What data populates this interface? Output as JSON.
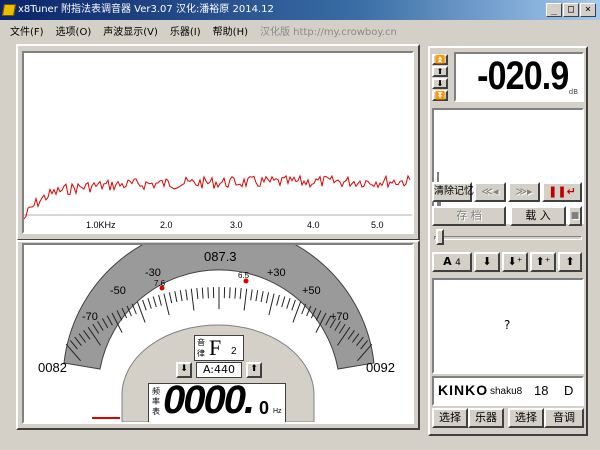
{
  "window": {
    "title": "x8Tuner 附指法表调音器 Ver3.07 汉化:潘裕原 2014.12",
    "minimize_glyph": "_",
    "maximize_glyph": "□",
    "close_glyph": "×"
  },
  "menu": {
    "items": [
      "文件(F)",
      "选项(O)",
      "声波显示(V)",
      "乐器(I)",
      "帮助(H)"
    ],
    "extra": "汉化版 http://my.crowboy.cn"
  },
  "spectrum": {
    "tick_labels": [
      "1.0KHz",
      "2.0",
      "3.0",
      "4.0",
      "5.0"
    ],
    "line_color": "#e00000"
  },
  "gauge": {
    "center_value": "087.3",
    "scale_labels": [
      "-70",
      "-50",
      "-30",
      "+30",
      "+50",
      "+70"
    ],
    "left_freq": "0082",
    "right_freq": "0092",
    "marker_left": "7.6",
    "marker_right": "6.5",
    "note_label_1": "音",
    "note_label_2": "律",
    "note_name": "F",
    "note_octave": "2",
    "a4_label": "A:440",
    "freq_label_1": "频",
    "freq_label_2": "率",
    "freq_label_3": "表",
    "freq_value_main": "0000.",
    "freq_value_decimal": "0",
    "freq_unit": "Hz"
  },
  "right_panel": {
    "db_value": "-020.9",
    "db_unit": "dB",
    "clear_memory": "清除记忆",
    "save_label": "存 档",
    "load_label": "载 入",
    "a_label": "A",
    "a_num": "4",
    "info_text": "?",
    "tuning_brand": "KINKO",
    "tuning_name": "shaku8",
    "tuning_num": "18",
    "tuning_key": "D",
    "bottom_buttons": [
      "选择",
      "乐器",
      "选择",
      "音调"
    ]
  }
}
